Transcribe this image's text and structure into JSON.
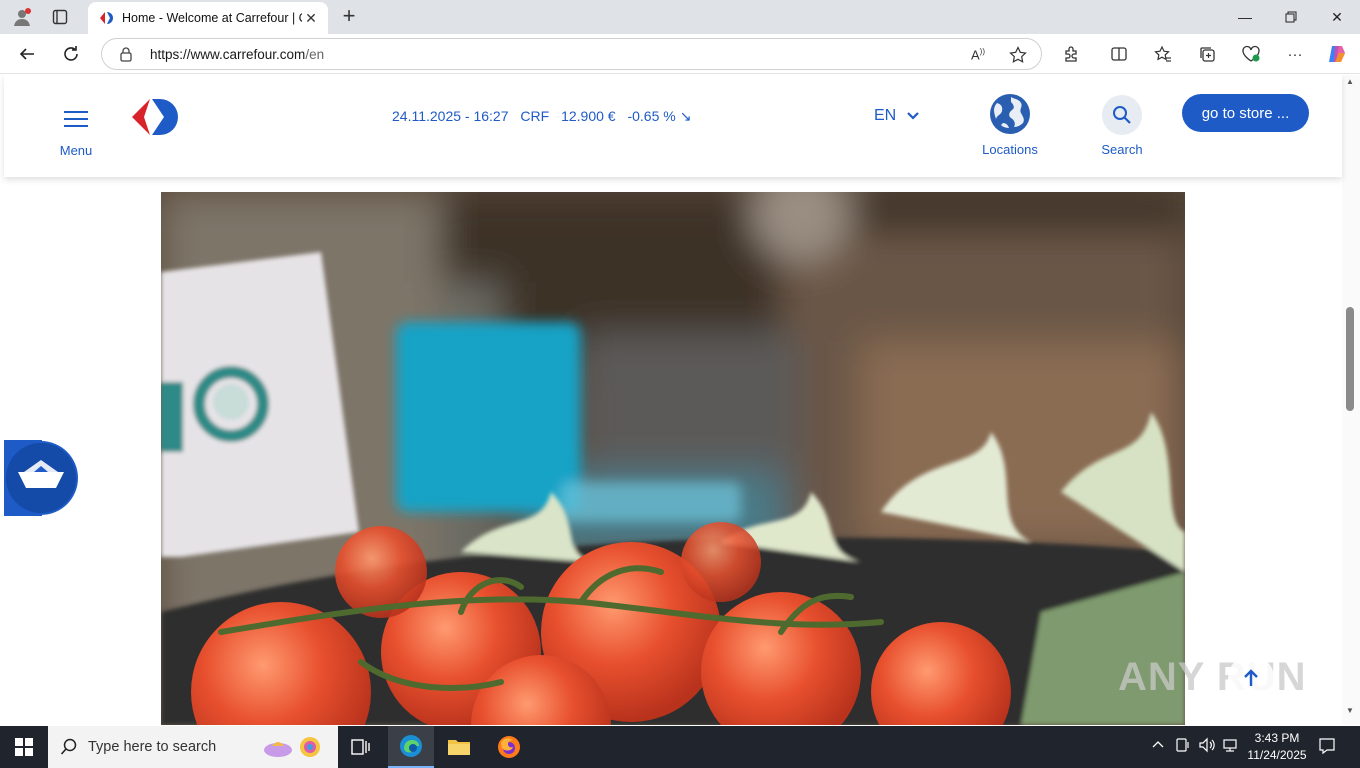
{
  "browser": {
    "tab_title": "Home - Welcome at Carrefour | C",
    "url_host": "https://www.carrefour.com",
    "url_path": "/en"
  },
  "header": {
    "menu_label": "Menu",
    "ticker": {
      "datetime": "24.11.2025 - 16:27",
      "symbol": "CRF",
      "price": "12.900 €",
      "change": "-0.65 %"
    },
    "language": "EN",
    "locations_label": "Locations",
    "search_label": "Search",
    "store_button": "go to store ..."
  },
  "colors": {
    "brand_blue": "#1e5bc6",
    "brand_red": "#d9232a"
  },
  "watermark": "ANY RUN",
  "taskbar": {
    "search_placeholder": "Type here to search",
    "time": "3:43 PM",
    "date": "11/24/2025"
  }
}
